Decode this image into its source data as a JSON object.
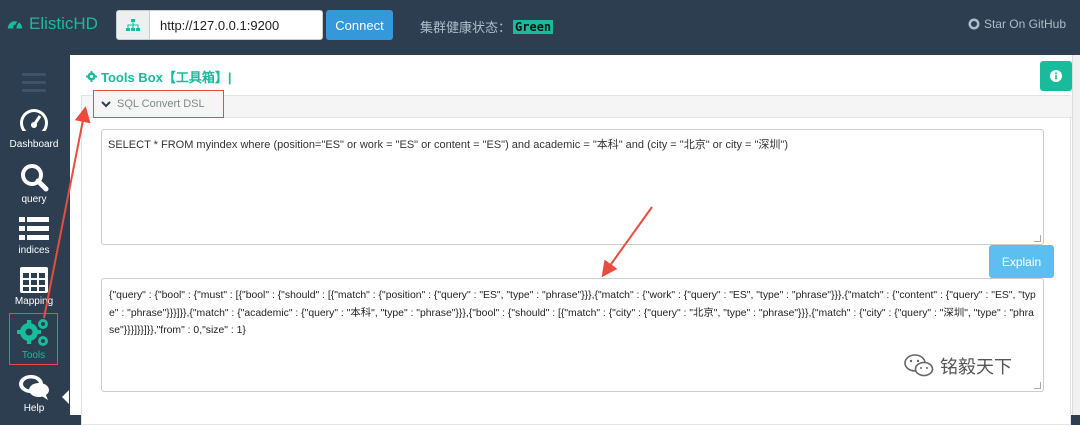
{
  "header": {
    "brand": "ElisticHD",
    "address_value": "http://127.0.0.1:9200",
    "connect_label": "Connect",
    "cluster_label": "集群健康状态：",
    "cluster_status": "Green",
    "github_label": "Star On GitHub"
  },
  "sidebar": {
    "items": [
      {
        "label": "Dashboard",
        "icon": "dashboard-icon"
      },
      {
        "label": "query",
        "icon": "search-icon"
      },
      {
        "label": "indices",
        "icon": "list-icon"
      },
      {
        "label": "Mapping",
        "icon": "table-icon"
      },
      {
        "label": "Tools",
        "icon": "gears-icon"
      },
      {
        "label": "Help",
        "icon": "chat-icon"
      }
    ]
  },
  "main": {
    "title": "Tools Box【工具箱】|",
    "section_label": "SQL Convert DSL",
    "sql_text": "SELECT * FROM myindex where (position=\"ES\" or work = \"ES\" or content = \"ES\") and academic = \"本科\" and (city = \"北京\" or city = \"深圳\")",
    "explain_label": "Explain",
    "dsl_text": "{\"query\" : {\"bool\" : {\"must\" : [{\"bool\" : {\"should\" : [{\"match\" : {\"position\" : {\"query\" : \"ES\", \"type\" : \"phrase\"}}},{\"match\" : {\"work\" : {\"query\" : \"ES\", \"type\" : \"phrase\"}}},{\"match\" : {\"content\" : {\"query\" : \"ES\", \"type\" : \"phrase\"}}}]}},{\"match\" : {\"academic\" : {\"query\" : \"本科\", \"type\" : \"phrase\"}}},{\"bool\" : {\"should\" : [{\"match\" : {\"city\" : {\"query\" : \"北京\", \"type\" : \"phrase\"}}},{\"match\" : {\"city\" : {\"query\" : \"深圳\", \"type\" : \"phrase\"}}}]}}]}},\"from\" : 0,\"size\" : 1}"
  },
  "watermark": "铭毅天下",
  "colors": {
    "accent": "#18bc9c",
    "navbar": "#2c3e50",
    "primary": "#3498db",
    "annotation": "#e74c3c"
  }
}
